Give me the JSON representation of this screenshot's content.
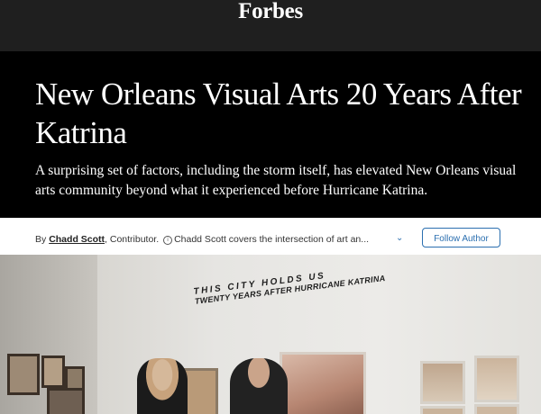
{
  "header": {
    "logo_text": "Forbes",
    "background": "#1f1f1f"
  },
  "article": {
    "headline": "New Orleans Visual Arts 20 Years After Katrina",
    "subhead": "A surprising set of factors, including the storm itself, has elevated New Orleans visual arts community beyond what it experienced before Hurricane Katrina."
  },
  "byline": {
    "by": "By",
    "author": "Chadd Scott",
    "role": ", Contributor.",
    "info_icon": "info-icon",
    "bio": "Chadd Scott covers the intersection of art an...",
    "expand_icon": "chevron-down-icon",
    "follow_label": "Follow Author",
    "accent": "#2b6fb0"
  },
  "photo": {
    "wall_line1": "THIS CITY HOLDS US",
    "wall_line2": "TWENTY YEARS AFTER HURRICANE KATRINA"
  }
}
